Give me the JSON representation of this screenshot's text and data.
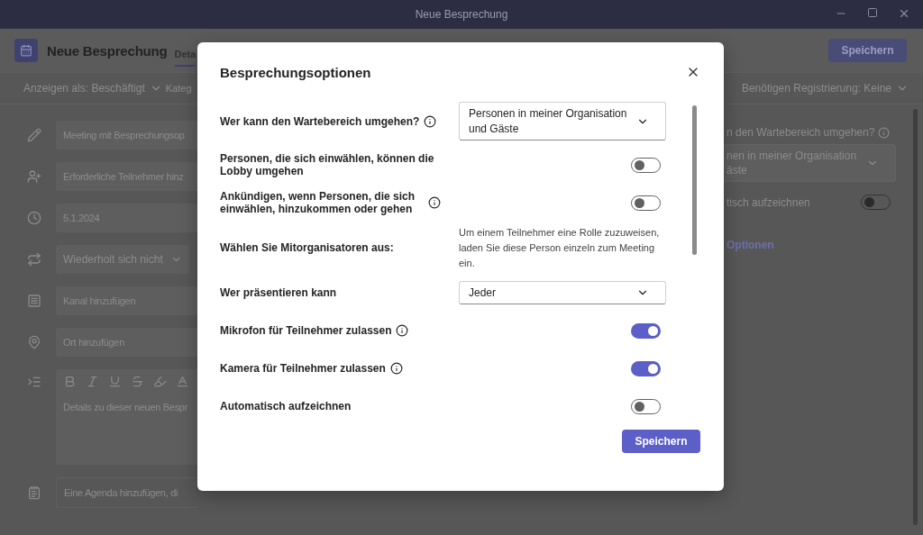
{
  "window": {
    "title": "Neue Besprechung"
  },
  "header": {
    "title": "Neue Besprechung",
    "tabs": [
      {
        "label": "Deta",
        "selected": true
      }
    ],
    "save_button": "Speichern"
  },
  "toolbar": {
    "show_as": "Anzeigen als: Beschäftigt",
    "category": "Kateg",
    "registration": "Benötigen Registrierung: Keine"
  },
  "form": {
    "fields": [
      {
        "kind": "value",
        "value": "Meeting mit Besprechungsop"
      },
      {
        "kind": "placeholder",
        "placeholder": "Erforderliche Teilnehmer hinz"
      },
      {
        "kind": "value",
        "value": "5.1.2024"
      },
      {
        "kind": "dropdown",
        "value": "Wiederholt sich nicht"
      },
      {
        "kind": "placeholder",
        "placeholder": "Kanal hinzufügen"
      },
      {
        "kind": "placeholder",
        "placeholder": "Ort hinzufügen"
      }
    ],
    "details": {
      "placeholder": "Details zu dieser neuen Bespr"
    },
    "agenda": {
      "placeholder": "Eine Agenda hinzufügen, di"
    }
  },
  "side_panel": {
    "lobby_label": "n den Wartebereich umgehen?",
    "lobby_value": [
      "nen in meiner Organisation",
      "äste"
    ],
    "record": {
      "label": "tisch aufzeichnen",
      "on": false
    },
    "link": "Optionen"
  },
  "dialog": {
    "title": "Besprechungsoptionen",
    "options": [
      {
        "kind": "select",
        "label": "Wer kann den Wartebereich umgehen?",
        "info": true,
        "value": "Personen in meiner Organisation und Gäste"
      },
      {
        "kind": "toggle",
        "label": "Personen, die sich einwählen, können die Lobby umgehen",
        "info": false,
        "on": false
      },
      {
        "kind": "toggle",
        "label": "Ankündigen, wenn Personen, die sich einwählen, hinzukommen oder gehen",
        "info": true,
        "on": false
      },
      {
        "kind": "note",
        "label": "Wählen Sie Mitorganisatoren aus:",
        "info": false,
        "text": "Um einem Teilnehmer eine Rolle zuzuweisen, laden Sie diese Person einzeln zum Meeting ein."
      },
      {
        "kind": "select",
        "label": "Wer präsentieren kann",
        "info": false,
        "value": "Jeder"
      },
      {
        "kind": "toggle",
        "label": "Mikrofon für Teilnehmer zulassen",
        "info": true,
        "on": true
      },
      {
        "kind": "toggle",
        "label": "Kamera für Teilnehmer zulassen",
        "info": true,
        "on": true
      },
      {
        "kind": "toggle",
        "label": "Automatisch aufzeichnen",
        "info": false,
        "on": false
      }
    ],
    "save_button": "Speichern"
  }
}
